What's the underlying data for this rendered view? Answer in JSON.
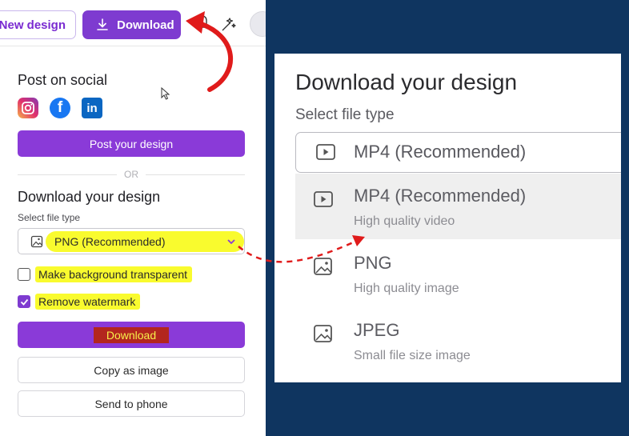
{
  "left_panel": {
    "topbar": {
      "new_design_label": "New design",
      "download_label": "Download"
    },
    "post_social": {
      "title": "Post on social",
      "social_icons": [
        "instagram-icon",
        "facebook-icon",
        "linkedin-icon"
      ],
      "post_button": "Post your design"
    },
    "divider_text": "OR",
    "download_section": {
      "title": "Download your design",
      "file_type_label": "Select file type",
      "file_type_value": "PNG (Recommended)",
      "checkbox_transparent": {
        "label": "Make background transparent",
        "checked": false
      },
      "checkbox_watermark": {
        "label": "Remove watermark",
        "checked": true
      },
      "download_button": "Download",
      "copy_button": "Copy as image",
      "phone_button": "Send to phone"
    }
  },
  "right_panel": {
    "title": "Download your design",
    "file_type_label": "Select file type",
    "selected_value": "MP4 (Recommended)",
    "options": [
      {
        "name": "MP4 (Recommended)",
        "desc": "High quality video",
        "icon": "video-play-icon",
        "highlighted": true
      },
      {
        "name": "PNG",
        "desc": "High quality image",
        "icon": "image-icon",
        "highlighted": false
      },
      {
        "name": "JPEG",
        "desc": "Small file size image",
        "icon": "image-icon",
        "highlighted": false
      }
    ]
  },
  "colors": {
    "background": "#0f3560",
    "brand_purple": "#7e3bd0",
    "highlight_yellow": "#f9fb2e",
    "annotation_red": "#e01b1b"
  }
}
